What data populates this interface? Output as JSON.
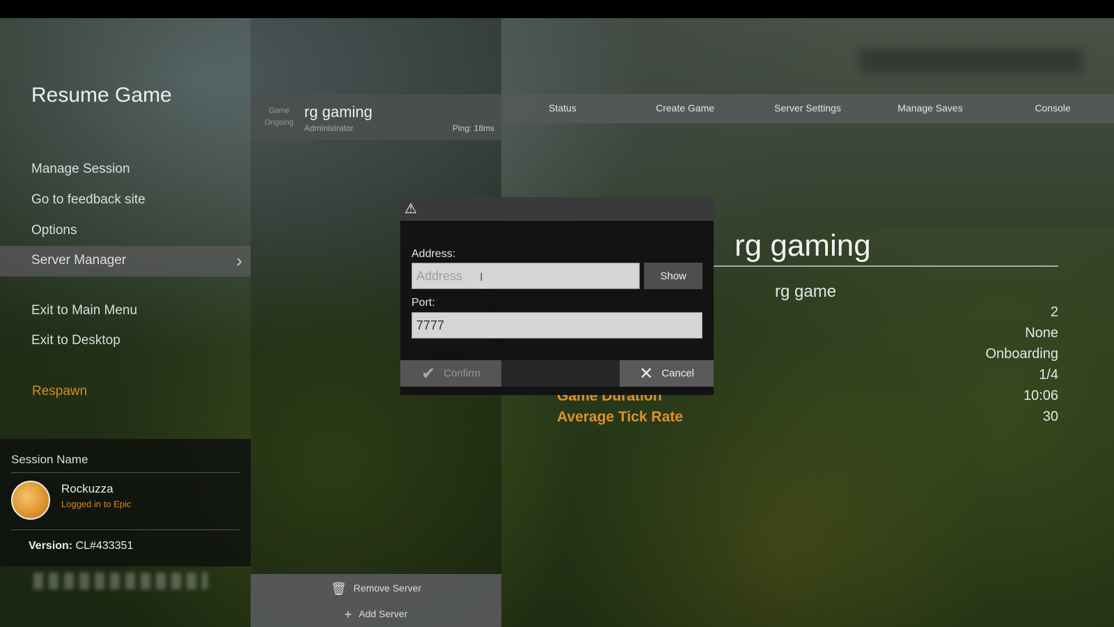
{
  "sidebar": {
    "title": "Resume Game",
    "items": [
      {
        "label": "Manage Session"
      },
      {
        "label": "Go to feedback site"
      },
      {
        "label": "Options"
      },
      {
        "label": "Server Manager"
      },
      {
        "label": "Exit to Main Menu"
      },
      {
        "label": "Exit to Desktop"
      },
      {
        "label": "Respawn"
      }
    ],
    "session": {
      "heading": "Session Name",
      "username": "Rockuzza",
      "status": "Logged in to Epic",
      "version_label": "Version:",
      "version_value": "CL#433351"
    }
  },
  "server_card": {
    "state_line1": "Game",
    "state_line2": "Ongoing",
    "name": "rg gaming",
    "role": "Administrator",
    "ping": "Ping: 18ms"
  },
  "tabs": [
    "Status",
    "Create Game",
    "Server Settings",
    "Manage Saves",
    "Console"
  ],
  "server_actions": {
    "remove": "Remove Server",
    "add": "Add Server"
  },
  "status_panel": {
    "title": "rg gaming",
    "session": "rg game",
    "values": [
      "2",
      "None",
      "Onboarding",
      "1/4",
      "10:06",
      "30"
    ],
    "labels": [
      "Game Duration",
      "Average Tick Rate"
    ]
  },
  "dialog": {
    "address_label": "Address:",
    "address_placeholder": "Address",
    "address_value": "",
    "show_label": "Show",
    "port_label": "Port:",
    "port_value": "7777",
    "confirm_label": "Confirm",
    "cancel_label": "Cancel"
  },
  "colors": {
    "accent_orange": "#e0902b",
    "panel_gray": "#555555"
  }
}
